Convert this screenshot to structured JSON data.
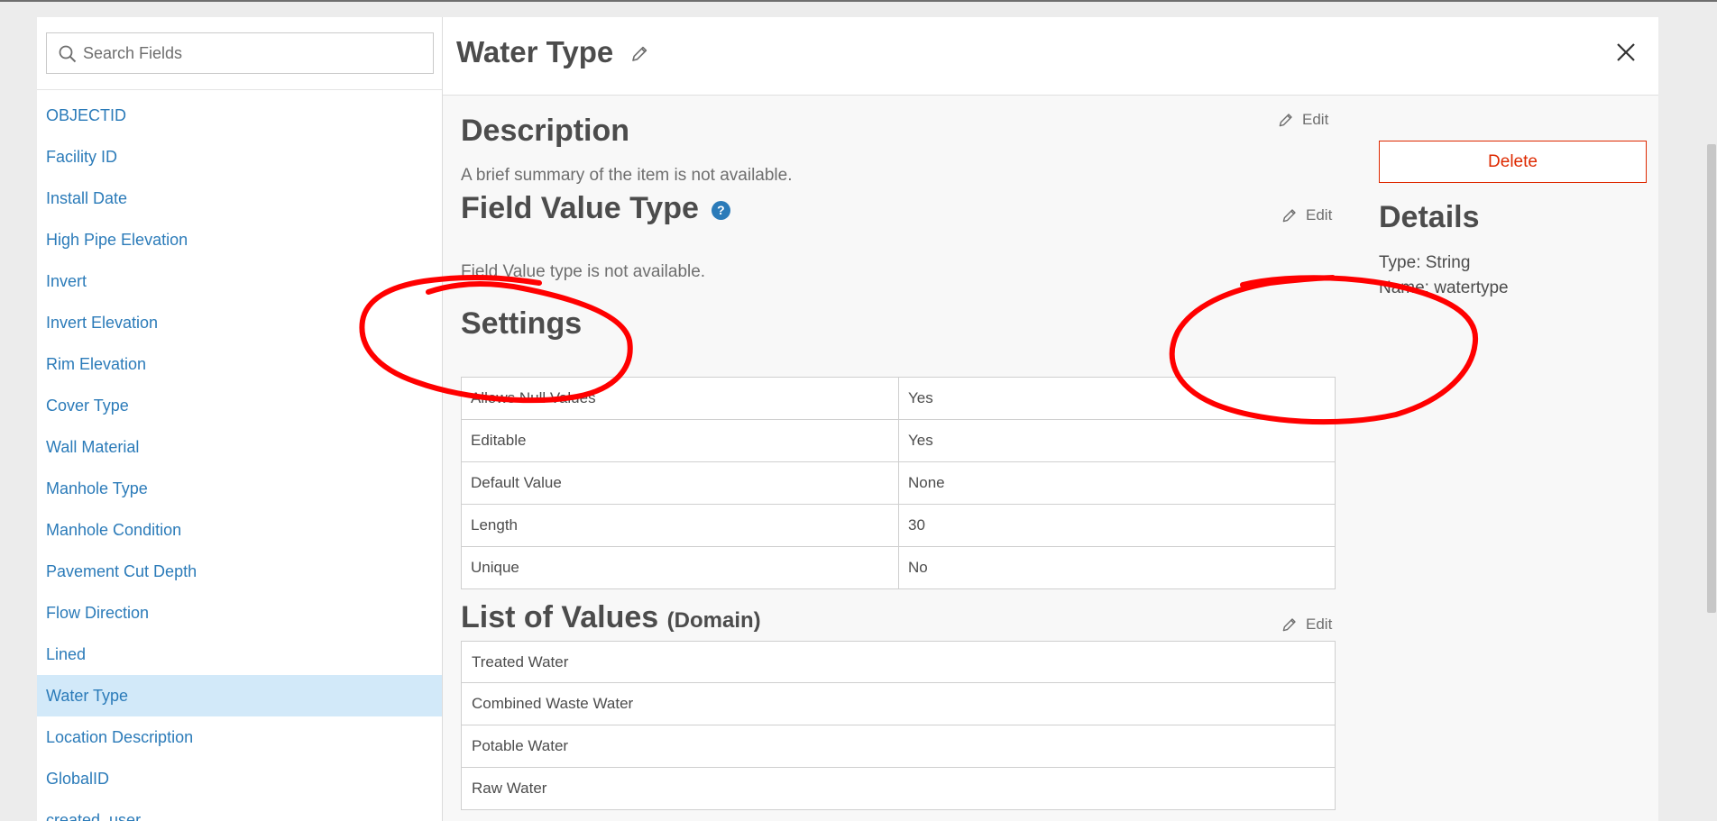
{
  "search": {
    "placeholder": "Search Fields",
    "value": ""
  },
  "field_list": {
    "items": [
      "OBJECTID",
      "Facility ID",
      "Install Date",
      "High Pipe Elevation",
      "Invert",
      "Invert Elevation",
      "Rim Elevation",
      "Cover Type",
      "Wall Material",
      "Manhole Type",
      "Manhole Condition",
      "Pavement Cut Depth",
      "Flow Direction",
      "Lined",
      "Water Type",
      "Location Description",
      "GlobalID",
      "created_user"
    ],
    "selected": "Water Type"
  },
  "detail": {
    "title": "Water Type",
    "description": {
      "heading": "Description",
      "text": "A brief summary of the item is not available.",
      "edit_label": "Edit"
    },
    "field_value_type": {
      "heading": "Field Value Type",
      "help_glyph": "?",
      "text": "Field Value type is not available.",
      "edit_label": "Edit"
    },
    "settings": {
      "heading": "Settings",
      "rows": [
        {
          "label": "Allows Null Values",
          "value": "Yes"
        },
        {
          "label": "Editable",
          "value": "Yes"
        },
        {
          "label": "Default Value",
          "value": "None"
        },
        {
          "label": "Length",
          "value": "30"
        },
        {
          "label": "Unique",
          "value": "No"
        }
      ]
    },
    "domain": {
      "heading": "List of Values",
      "subheading": "(Domain)",
      "edit_label": "Edit",
      "values": [
        "Treated Water",
        "Combined Waste Water",
        "Potable Water",
        "Raw Water"
      ]
    }
  },
  "sidebar_details": {
    "delete_label": "Delete",
    "heading": "Details",
    "type_line": "Type: String",
    "name_line": "Name: watertype"
  },
  "colors": {
    "link": "#2b7bb9",
    "selected_row": "#d2e9f9",
    "danger": "#de2900",
    "annotation": "#ff0000"
  },
  "icons": [
    "search-icon",
    "pencil-icon",
    "close-icon",
    "help-icon"
  ]
}
